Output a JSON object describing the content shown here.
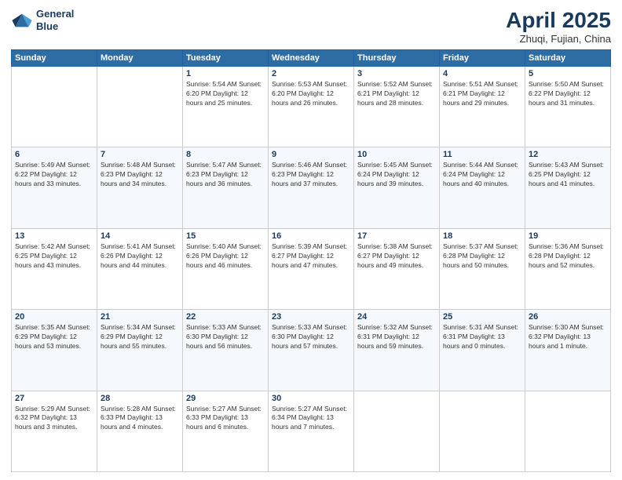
{
  "header": {
    "logo_line1": "General",
    "logo_line2": "Blue",
    "title": "April 2025",
    "location": "Zhuqi, Fujian, China"
  },
  "days_of_week": [
    "Sunday",
    "Monday",
    "Tuesday",
    "Wednesday",
    "Thursday",
    "Friday",
    "Saturday"
  ],
  "weeks": [
    [
      {
        "day": "",
        "info": ""
      },
      {
        "day": "",
        "info": ""
      },
      {
        "day": "1",
        "info": "Sunrise: 5:54 AM\nSunset: 6:20 PM\nDaylight: 12 hours\nand 25 minutes."
      },
      {
        "day": "2",
        "info": "Sunrise: 5:53 AM\nSunset: 6:20 PM\nDaylight: 12 hours\nand 26 minutes."
      },
      {
        "day": "3",
        "info": "Sunrise: 5:52 AM\nSunset: 6:21 PM\nDaylight: 12 hours\nand 28 minutes."
      },
      {
        "day": "4",
        "info": "Sunrise: 5:51 AM\nSunset: 6:21 PM\nDaylight: 12 hours\nand 29 minutes."
      },
      {
        "day": "5",
        "info": "Sunrise: 5:50 AM\nSunset: 6:22 PM\nDaylight: 12 hours\nand 31 minutes."
      }
    ],
    [
      {
        "day": "6",
        "info": "Sunrise: 5:49 AM\nSunset: 6:22 PM\nDaylight: 12 hours\nand 33 minutes."
      },
      {
        "day": "7",
        "info": "Sunrise: 5:48 AM\nSunset: 6:23 PM\nDaylight: 12 hours\nand 34 minutes."
      },
      {
        "day": "8",
        "info": "Sunrise: 5:47 AM\nSunset: 6:23 PM\nDaylight: 12 hours\nand 36 minutes."
      },
      {
        "day": "9",
        "info": "Sunrise: 5:46 AM\nSunset: 6:23 PM\nDaylight: 12 hours\nand 37 minutes."
      },
      {
        "day": "10",
        "info": "Sunrise: 5:45 AM\nSunset: 6:24 PM\nDaylight: 12 hours\nand 39 minutes."
      },
      {
        "day": "11",
        "info": "Sunrise: 5:44 AM\nSunset: 6:24 PM\nDaylight: 12 hours\nand 40 minutes."
      },
      {
        "day": "12",
        "info": "Sunrise: 5:43 AM\nSunset: 6:25 PM\nDaylight: 12 hours\nand 41 minutes."
      }
    ],
    [
      {
        "day": "13",
        "info": "Sunrise: 5:42 AM\nSunset: 6:25 PM\nDaylight: 12 hours\nand 43 minutes."
      },
      {
        "day": "14",
        "info": "Sunrise: 5:41 AM\nSunset: 6:26 PM\nDaylight: 12 hours\nand 44 minutes."
      },
      {
        "day": "15",
        "info": "Sunrise: 5:40 AM\nSunset: 6:26 PM\nDaylight: 12 hours\nand 46 minutes."
      },
      {
        "day": "16",
        "info": "Sunrise: 5:39 AM\nSunset: 6:27 PM\nDaylight: 12 hours\nand 47 minutes."
      },
      {
        "day": "17",
        "info": "Sunrise: 5:38 AM\nSunset: 6:27 PM\nDaylight: 12 hours\nand 49 minutes."
      },
      {
        "day": "18",
        "info": "Sunrise: 5:37 AM\nSunset: 6:28 PM\nDaylight: 12 hours\nand 50 minutes."
      },
      {
        "day": "19",
        "info": "Sunrise: 5:36 AM\nSunset: 6:28 PM\nDaylight: 12 hours\nand 52 minutes."
      }
    ],
    [
      {
        "day": "20",
        "info": "Sunrise: 5:35 AM\nSunset: 6:29 PM\nDaylight: 12 hours\nand 53 minutes."
      },
      {
        "day": "21",
        "info": "Sunrise: 5:34 AM\nSunset: 6:29 PM\nDaylight: 12 hours\nand 55 minutes."
      },
      {
        "day": "22",
        "info": "Sunrise: 5:33 AM\nSunset: 6:30 PM\nDaylight: 12 hours\nand 56 minutes."
      },
      {
        "day": "23",
        "info": "Sunrise: 5:33 AM\nSunset: 6:30 PM\nDaylight: 12 hours\nand 57 minutes."
      },
      {
        "day": "24",
        "info": "Sunrise: 5:32 AM\nSunset: 6:31 PM\nDaylight: 12 hours\nand 59 minutes."
      },
      {
        "day": "25",
        "info": "Sunrise: 5:31 AM\nSunset: 6:31 PM\nDaylight: 13 hours\nand 0 minutes."
      },
      {
        "day": "26",
        "info": "Sunrise: 5:30 AM\nSunset: 6:32 PM\nDaylight: 13 hours\nand 1 minute."
      }
    ],
    [
      {
        "day": "27",
        "info": "Sunrise: 5:29 AM\nSunset: 6:32 PM\nDaylight: 13 hours\nand 3 minutes."
      },
      {
        "day": "28",
        "info": "Sunrise: 5:28 AM\nSunset: 6:33 PM\nDaylight: 13 hours\nand 4 minutes."
      },
      {
        "day": "29",
        "info": "Sunrise: 5:27 AM\nSunset: 6:33 PM\nDaylight: 13 hours\nand 6 minutes."
      },
      {
        "day": "30",
        "info": "Sunrise: 5:27 AM\nSunset: 6:34 PM\nDaylight: 13 hours\nand 7 minutes."
      },
      {
        "day": "",
        "info": ""
      },
      {
        "day": "",
        "info": ""
      },
      {
        "day": "",
        "info": ""
      }
    ]
  ]
}
